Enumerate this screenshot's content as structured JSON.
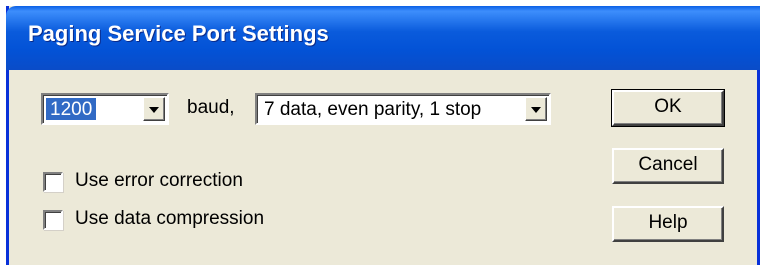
{
  "window": {
    "title": "Paging Service Port Settings"
  },
  "baud": {
    "selected": "1200",
    "unit_label": "baud,"
  },
  "format": {
    "selected": "7 data, even parity, 1 stop"
  },
  "options": {
    "error_correction": {
      "label": "Use error correction",
      "checked": false
    },
    "data_compression": {
      "label": "Use data compression",
      "checked": false
    }
  },
  "buttons": {
    "ok": "OK",
    "cancel": "Cancel",
    "help": "Help"
  },
  "colors": {
    "title_bar": "#0a5bdc",
    "dialog_bg": "#ece9d8",
    "selection": "#316ac5"
  }
}
